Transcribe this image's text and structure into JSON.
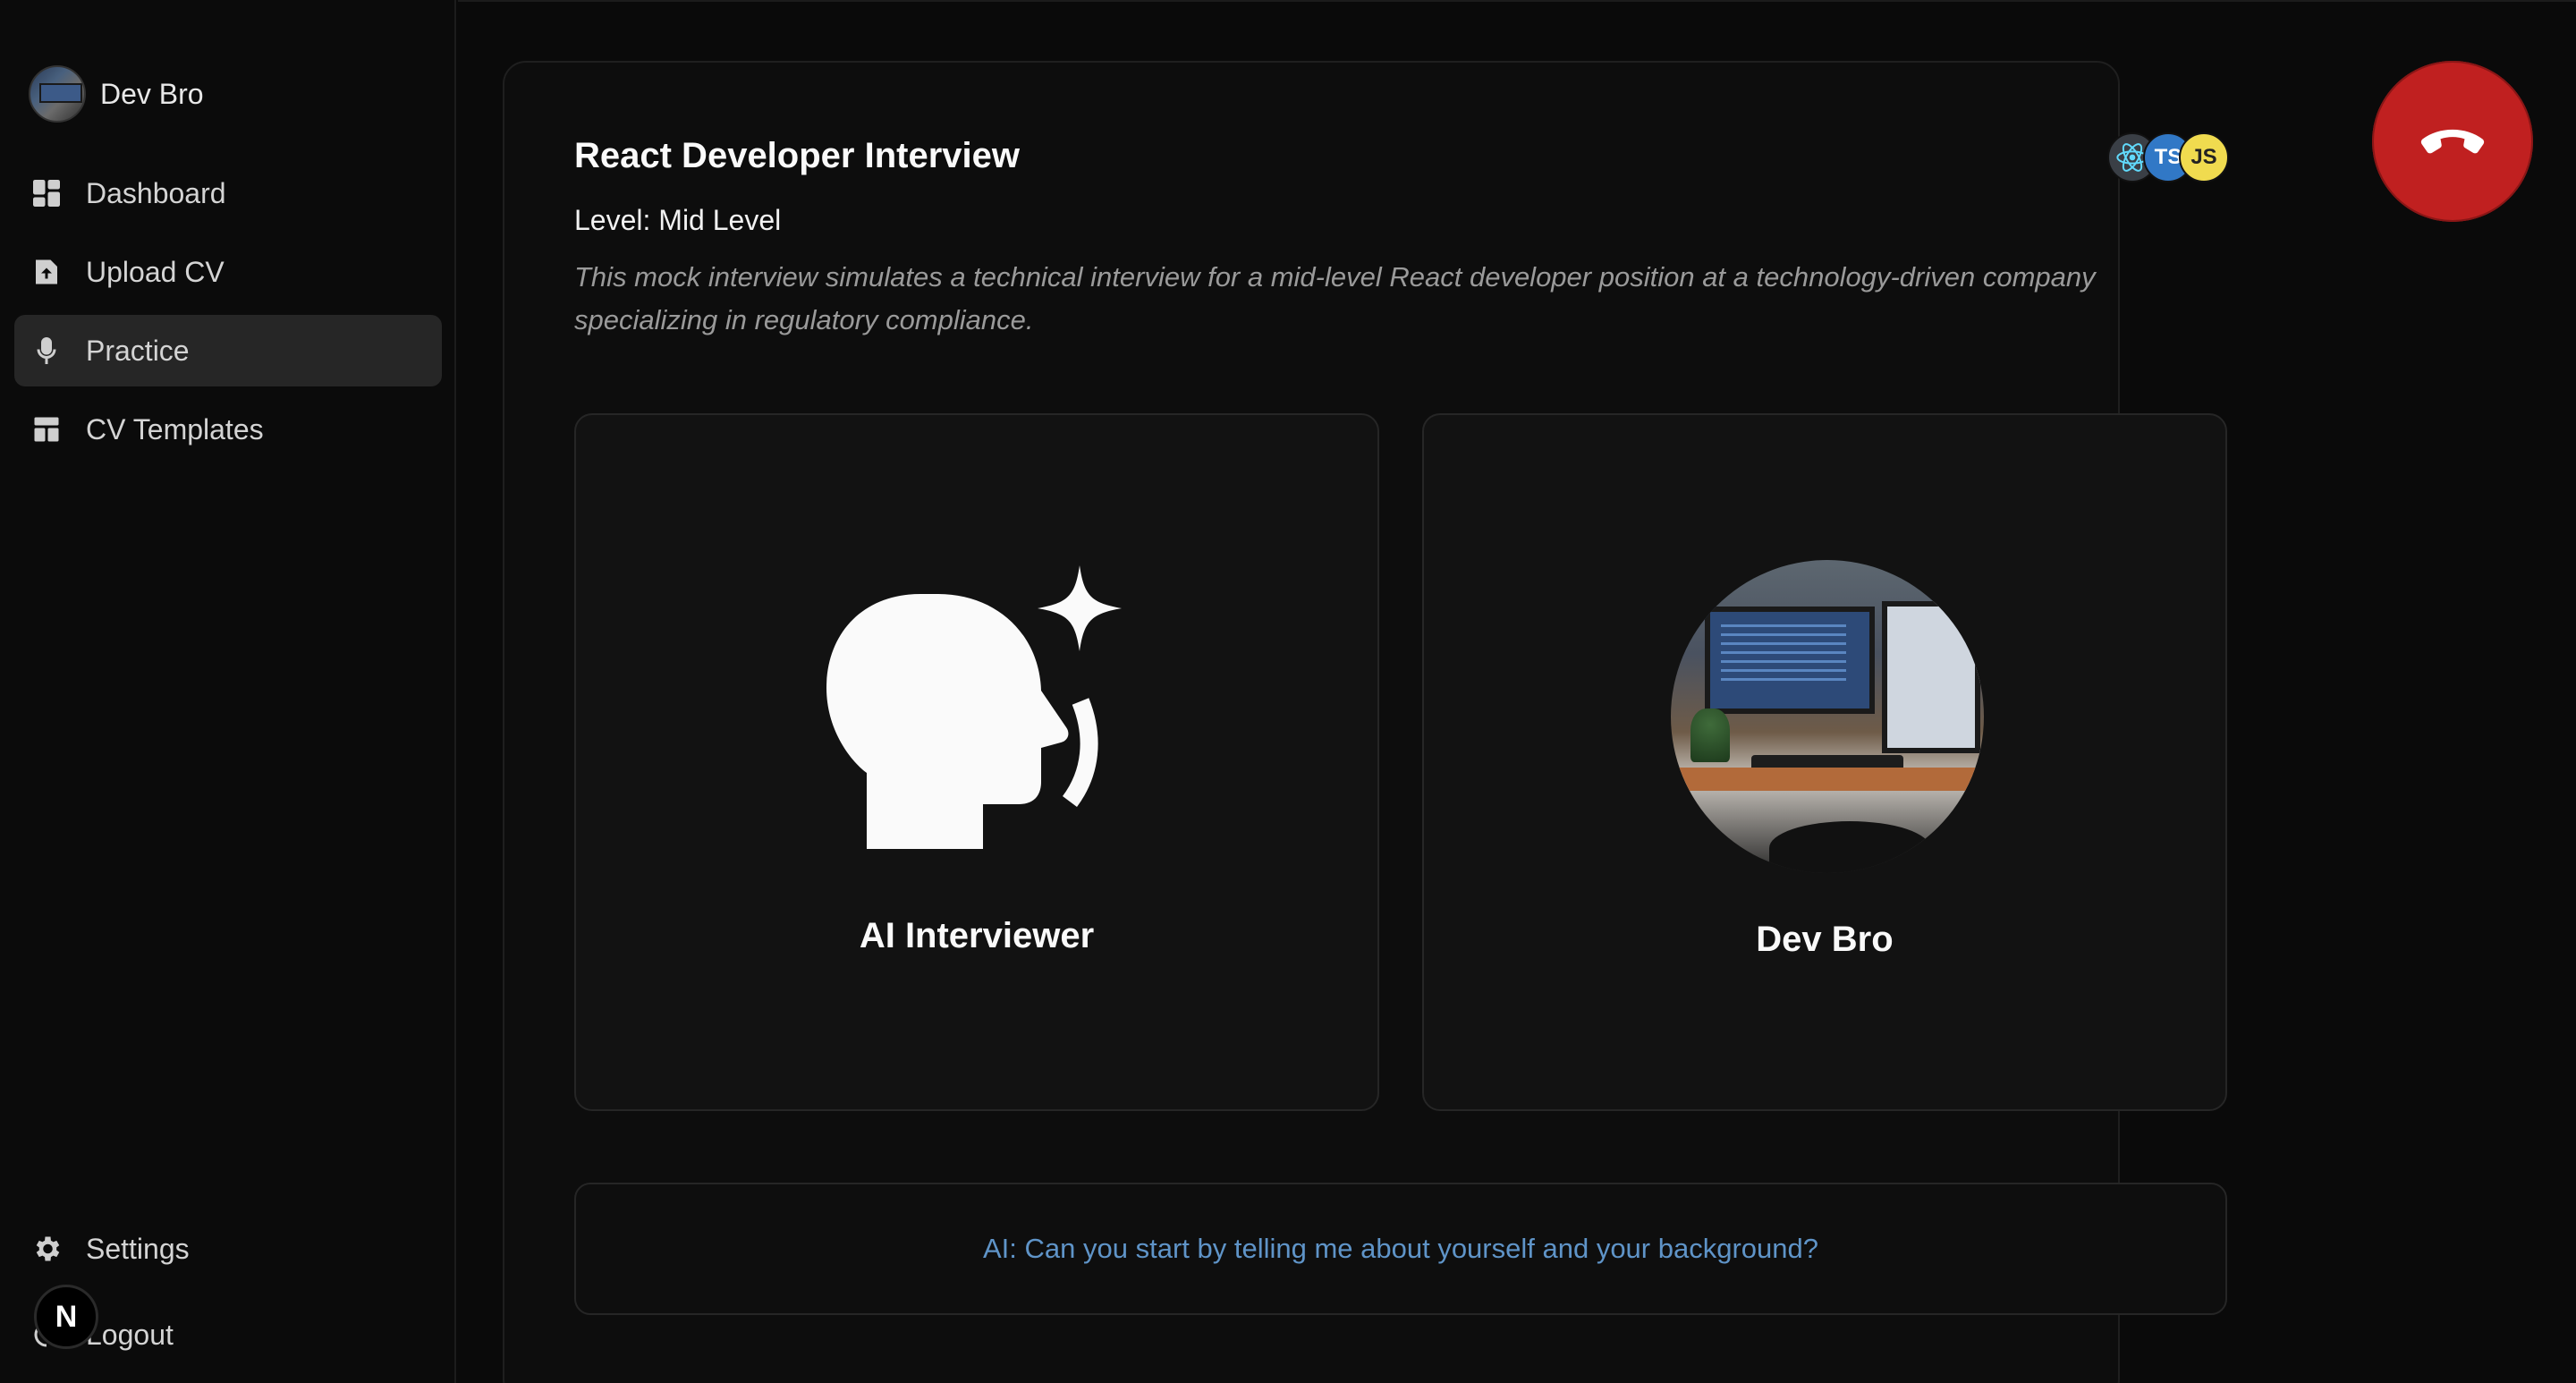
{
  "sidebar": {
    "user_name": "Dev Bro",
    "items": [
      {
        "label": "Dashboard",
        "icon": "dashboard-icon"
      },
      {
        "label": "Upload CV",
        "icon": "upload-icon"
      },
      {
        "label": "Practice",
        "icon": "microphone-icon",
        "active": true
      },
      {
        "label": "CV Templates",
        "icon": "template-icon"
      }
    ],
    "bottom": [
      {
        "label": "Settings",
        "icon": "gear-icon"
      },
      {
        "label": "Logout",
        "icon": "logout-icon"
      }
    ],
    "badge": "N"
  },
  "interview": {
    "title": "React Developer Interview",
    "level": "Level: Mid Level",
    "description": "This mock interview simulates a technical interview for a mid-level React developer position at a technology-driven company specializing in regulatory compliance.",
    "tech_stack": [
      "React",
      "TS",
      "JS"
    ]
  },
  "panels": {
    "ai_label": "AI Interviewer",
    "user_label": "Dev Bro"
  },
  "transcript": {
    "text": "AI: Can you start by telling me about yourself and your background?"
  },
  "colors": {
    "end_call": "#c02020",
    "transcript_text": "#5f94c8",
    "active_nav": "#262626"
  }
}
